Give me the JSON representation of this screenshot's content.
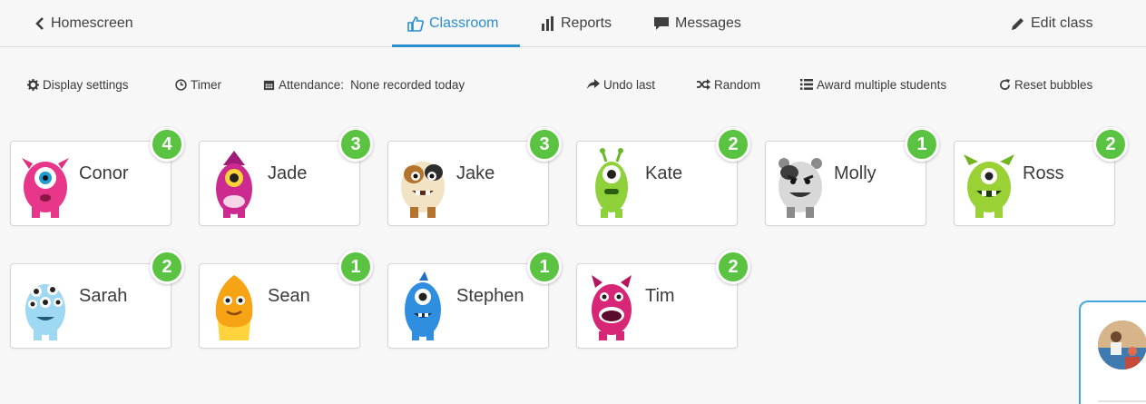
{
  "nav": {
    "back_label": "Homescreen",
    "tabs": [
      {
        "label": "Classroom",
        "icon": "thumbs-up-icon",
        "active": true
      },
      {
        "label": "Reports",
        "icon": "bar-chart-icon",
        "active": false
      },
      {
        "label": "Messages",
        "icon": "speech-bubble-icon",
        "active": false
      }
    ],
    "edit_label": "Edit class"
  },
  "toolbar": {
    "display_settings": "Display settings",
    "timer": "Timer",
    "attendance_label": "Attendance:",
    "attendance_value": "None recorded today",
    "undo": "Undo last",
    "random": "Random",
    "award_multiple": "Award multiple students",
    "reset_bubbles": "Reset bubbles"
  },
  "students": [
    {
      "name": "Conor",
      "points": "4",
      "monster": "pink-fuzzy-monster"
    },
    {
      "name": "Jade",
      "points": "3",
      "monster": "magenta-one-eye-monster"
    },
    {
      "name": "Jake",
      "points": "3",
      "monster": "brown-patched-monster"
    },
    {
      "name": "Kate",
      "points": "2",
      "monster": "green-antenna-monster"
    },
    {
      "name": "Molly",
      "points": "1",
      "monster": "grey-monster"
    },
    {
      "name": "Ross",
      "points": "2",
      "monster": "lime-horned-monster"
    },
    {
      "name": "Sarah",
      "points": "2",
      "monster": "blue-multi-eye-monster"
    },
    {
      "name": "Sean",
      "points": "1",
      "monster": "orange-flame-monster"
    },
    {
      "name": "Stephen",
      "points": "1",
      "monster": "blue-furry-monster"
    },
    {
      "name": "Tim",
      "points": "2",
      "monster": "pink-big-mouth-monster"
    }
  ],
  "colors": {
    "accent": "#2a8fd0",
    "badge": "#5ac341"
  }
}
